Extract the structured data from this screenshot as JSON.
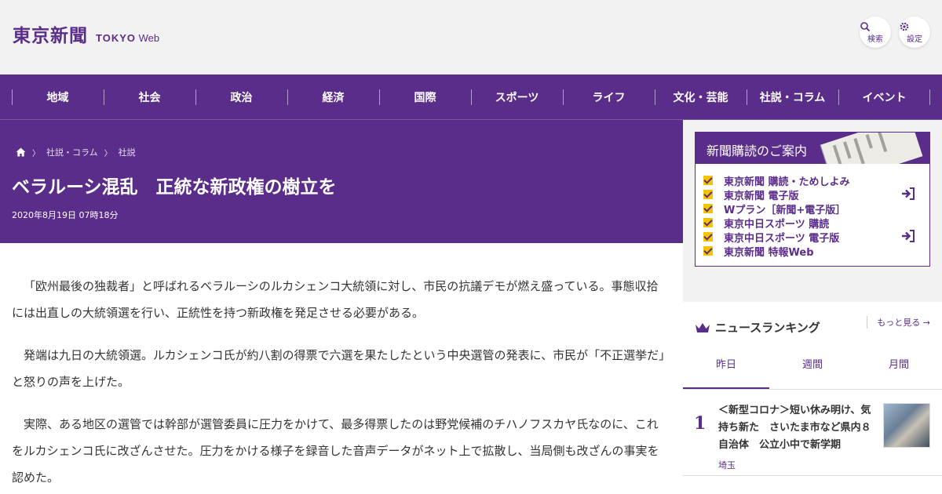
{
  "header": {
    "logo_jp": "東京新聞",
    "logo_en_bold": "TOKYO",
    "logo_en_light": "Web",
    "search_label": "検索",
    "settings_label": "設定"
  },
  "nav": {
    "items": [
      "地域",
      "社会",
      "政治",
      "経済",
      "国際",
      "スポーツ",
      "ライフ",
      "文化・芸能",
      "社説・コラム",
      "イベント"
    ]
  },
  "article": {
    "breadcrumb": [
      "社説・コラム",
      "社説"
    ],
    "title": "ベラルーシ混乱　正統な新政権の樹立を",
    "date": "2020年8月19日 07時18分",
    "paragraphs": [
      "「欧州最後の独裁者」と呼ばれるベラルーシのルカシェンコ大統領に対し、市民の抗議デモが燃え盛っている。事態収拾には出直しの大統領選を行い、正統性を持つ新政権を発足させる必要がある。",
      "発端は九日の大統領選。ルカシェンコ氏が約八割の得票で六選を果たしたという中央選管の発表に、市民が「不正選挙だ」と怒りの声を上げた。",
      "実際、ある地区の選管では幹部が選管委員に圧力をかけて、最多得票したのは野党候補のチハノフスカヤ氏なのに、これをルカシェンコ氏に改ざんさせた。圧力をかける様子を録音した音声データがネット上で拡散し、当局側も改ざんの事実を認めた。"
    ]
  },
  "subscription": {
    "heading": "新聞購読のご案内",
    "items": [
      "東京新聞 購読・ためしよみ",
      "東京新聞 電子版",
      "Wプラン［新聞+電子版］",
      "東京中日スポーツ 購読",
      "東京中日スポーツ 電子版",
      "東京新聞 特報Web"
    ]
  },
  "ranking": {
    "heading": "ニュースランキング",
    "more": "もっと見る",
    "tabs": [
      "昨日",
      "週間",
      "月間"
    ],
    "items": [
      {
        "rank": "1",
        "text": "＜新型コロナ＞短い休み明け、気持ち新た　さいたま市など県内８自治体　公立小中で新学期",
        "category": "埼玉"
      }
    ]
  },
  "colors": {
    "brand": "#5a2d8a",
    "check": "#f5c400"
  }
}
